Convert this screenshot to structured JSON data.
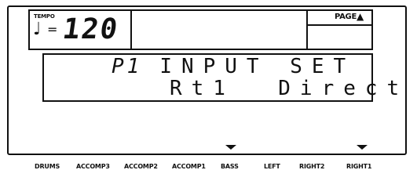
{
  "display": {
    "tempo_label": "TEMPO",
    "tempo_note_glyph": "♩",
    "tempo_eq": "=",
    "tempo_value": "120",
    "page_label": "PAGE",
    "page_arrow": "▲",
    "line1_page": "P1",
    "line1_text": "INPUT SET",
    "line2_text": "Rt1  Direct"
  },
  "buttons": [
    {
      "name": "drums",
      "label": "DRUMS",
      "marker": false
    },
    {
      "name": "accomp3",
      "label": "ACCOMP3",
      "marker": false
    },
    {
      "name": "accomp2",
      "label": "ACCOMP2",
      "marker": false
    },
    {
      "name": "accomp1",
      "label": "ACCOMP1",
      "marker": false
    },
    {
      "name": "bass",
      "label": "BASS",
      "marker": true
    },
    {
      "name": "left",
      "label": "LEFT",
      "marker": false
    },
    {
      "name": "right2",
      "label": "RIGHT2",
      "marker": false
    },
    {
      "name": "right1",
      "label": "RIGHT1",
      "marker": true
    }
  ]
}
